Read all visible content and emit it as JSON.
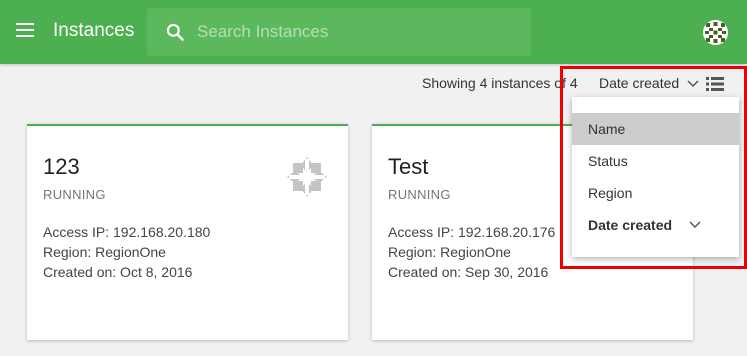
{
  "appbar": {
    "title": "Instances",
    "search_placeholder": "Search Instances",
    "color": "#4caf50"
  },
  "toolbar": {
    "showing_text": "Showing 4 instances of 4",
    "sort_label": "Date created"
  },
  "instances": [
    {
      "name": "123",
      "status": "RUNNING",
      "access_ip": "Access IP: 192.168.20.180",
      "region": "Region: RegionOne",
      "created": "Created on: Oct 8, 2016",
      "icon": "centos-logo-icon"
    },
    {
      "name": "Test",
      "status": "RUNNING",
      "access_ip": "Access IP: 192.168.20.176",
      "region": "Region: RegionOne",
      "created": "Created on: Sep 30, 2016"
    }
  ],
  "sort_menu": {
    "items": [
      {
        "label": "Name",
        "highlighted": true
      },
      {
        "label": "Status"
      },
      {
        "label": "Region"
      },
      {
        "label": "Date created",
        "selected": true
      }
    ],
    "outline_color": "#e00000"
  }
}
